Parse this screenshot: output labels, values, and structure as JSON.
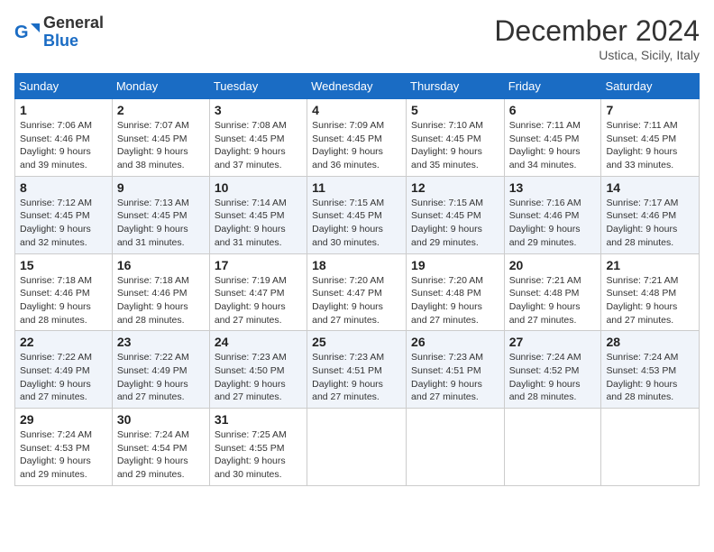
{
  "header": {
    "logo_line1": "General",
    "logo_line2": "Blue",
    "month": "December 2024",
    "location": "Ustica, Sicily, Italy"
  },
  "weekdays": [
    "Sunday",
    "Monday",
    "Tuesday",
    "Wednesday",
    "Thursday",
    "Friday",
    "Saturday"
  ],
  "weeks": [
    [
      {
        "day": "1",
        "sunrise": "7:06 AM",
        "sunset": "4:46 PM",
        "daylight": "9 hours and 39 minutes."
      },
      {
        "day": "2",
        "sunrise": "7:07 AM",
        "sunset": "4:45 PM",
        "daylight": "9 hours and 38 minutes."
      },
      {
        "day": "3",
        "sunrise": "7:08 AM",
        "sunset": "4:45 PM",
        "daylight": "9 hours and 37 minutes."
      },
      {
        "day": "4",
        "sunrise": "7:09 AM",
        "sunset": "4:45 PM",
        "daylight": "9 hours and 36 minutes."
      },
      {
        "day": "5",
        "sunrise": "7:10 AM",
        "sunset": "4:45 PM",
        "daylight": "9 hours and 35 minutes."
      },
      {
        "day": "6",
        "sunrise": "7:11 AM",
        "sunset": "4:45 PM",
        "daylight": "9 hours and 34 minutes."
      },
      {
        "day": "7",
        "sunrise": "7:11 AM",
        "sunset": "4:45 PM",
        "daylight": "9 hours and 33 minutes."
      }
    ],
    [
      {
        "day": "8",
        "sunrise": "7:12 AM",
        "sunset": "4:45 PM",
        "daylight": "9 hours and 32 minutes."
      },
      {
        "day": "9",
        "sunrise": "7:13 AM",
        "sunset": "4:45 PM",
        "daylight": "9 hours and 31 minutes."
      },
      {
        "day": "10",
        "sunrise": "7:14 AM",
        "sunset": "4:45 PM",
        "daylight": "9 hours and 31 minutes."
      },
      {
        "day": "11",
        "sunrise": "7:15 AM",
        "sunset": "4:45 PM",
        "daylight": "9 hours and 30 minutes."
      },
      {
        "day": "12",
        "sunrise": "7:15 AM",
        "sunset": "4:45 PM",
        "daylight": "9 hours and 29 minutes."
      },
      {
        "day": "13",
        "sunrise": "7:16 AM",
        "sunset": "4:46 PM",
        "daylight": "9 hours and 29 minutes."
      },
      {
        "day": "14",
        "sunrise": "7:17 AM",
        "sunset": "4:46 PM",
        "daylight": "9 hours and 28 minutes."
      }
    ],
    [
      {
        "day": "15",
        "sunrise": "7:18 AM",
        "sunset": "4:46 PM",
        "daylight": "9 hours and 28 minutes."
      },
      {
        "day": "16",
        "sunrise": "7:18 AM",
        "sunset": "4:46 PM",
        "daylight": "9 hours and 28 minutes."
      },
      {
        "day": "17",
        "sunrise": "7:19 AM",
        "sunset": "4:47 PM",
        "daylight": "9 hours and 27 minutes."
      },
      {
        "day": "18",
        "sunrise": "7:20 AM",
        "sunset": "4:47 PM",
        "daylight": "9 hours and 27 minutes."
      },
      {
        "day": "19",
        "sunrise": "7:20 AM",
        "sunset": "4:48 PM",
        "daylight": "9 hours and 27 minutes."
      },
      {
        "day": "20",
        "sunrise": "7:21 AM",
        "sunset": "4:48 PM",
        "daylight": "9 hours and 27 minutes."
      },
      {
        "day": "21",
        "sunrise": "7:21 AM",
        "sunset": "4:48 PM",
        "daylight": "9 hours and 27 minutes."
      }
    ],
    [
      {
        "day": "22",
        "sunrise": "7:22 AM",
        "sunset": "4:49 PM",
        "daylight": "9 hours and 27 minutes."
      },
      {
        "day": "23",
        "sunrise": "7:22 AM",
        "sunset": "4:49 PM",
        "daylight": "9 hours and 27 minutes."
      },
      {
        "day": "24",
        "sunrise": "7:23 AM",
        "sunset": "4:50 PM",
        "daylight": "9 hours and 27 minutes."
      },
      {
        "day": "25",
        "sunrise": "7:23 AM",
        "sunset": "4:51 PM",
        "daylight": "9 hours and 27 minutes."
      },
      {
        "day": "26",
        "sunrise": "7:23 AM",
        "sunset": "4:51 PM",
        "daylight": "9 hours and 27 minutes."
      },
      {
        "day": "27",
        "sunrise": "7:24 AM",
        "sunset": "4:52 PM",
        "daylight": "9 hours and 28 minutes."
      },
      {
        "day": "28",
        "sunrise": "7:24 AM",
        "sunset": "4:53 PM",
        "daylight": "9 hours and 28 minutes."
      }
    ],
    [
      {
        "day": "29",
        "sunrise": "7:24 AM",
        "sunset": "4:53 PM",
        "daylight": "9 hours and 29 minutes."
      },
      {
        "day": "30",
        "sunrise": "7:24 AM",
        "sunset": "4:54 PM",
        "daylight": "9 hours and 29 minutes."
      },
      {
        "day": "31",
        "sunrise": "7:25 AM",
        "sunset": "4:55 PM",
        "daylight": "9 hours and 30 minutes."
      },
      null,
      null,
      null,
      null
    ]
  ],
  "labels": {
    "sunrise": "Sunrise:",
    "sunset": "Sunset:",
    "daylight": "Daylight:"
  }
}
